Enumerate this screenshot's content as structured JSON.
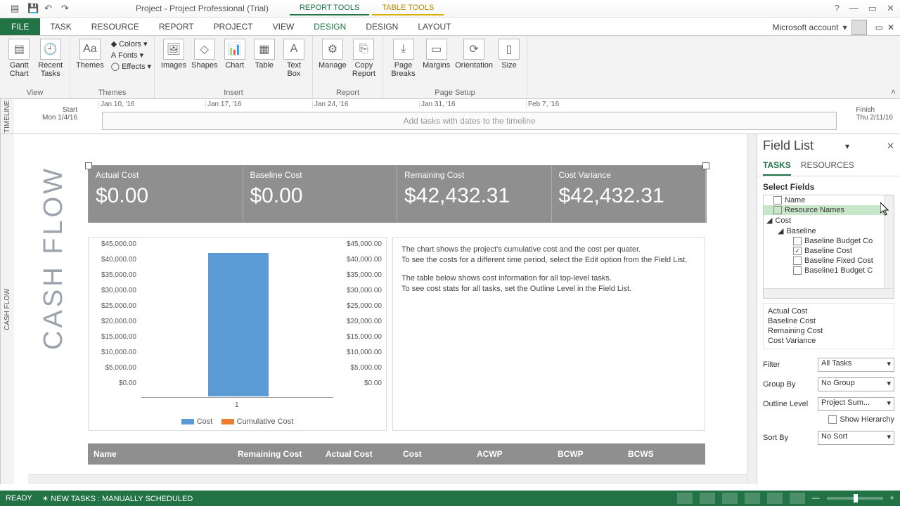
{
  "titlebar": {
    "app_title": "Project - Project Professional (Trial)",
    "tool_tabs": {
      "report": "REPORT TOOLS",
      "table": "TABLE TOOLS"
    }
  },
  "tabs": {
    "file": "FILE",
    "items": [
      "TASK",
      "RESOURCE",
      "REPORT",
      "PROJECT",
      "VIEW",
      "DESIGN",
      "DESIGN",
      "LAYOUT"
    ],
    "active_index": 5,
    "account": "Microsoft account"
  },
  "ribbon": {
    "view": {
      "gantt": "Gantt Chart",
      "recent": "Recent Tasks",
      "label": "View"
    },
    "themes": {
      "themes": "Themes",
      "colors": "Colors",
      "fonts": "Fonts",
      "effects": "Effects",
      "label": "Themes"
    },
    "insert": {
      "images": "Images",
      "shapes": "Shapes",
      "chart": "Chart",
      "table": "Table",
      "textbox": "Text Box",
      "label": "Insert"
    },
    "report": {
      "manage": "Manage",
      "copy": "Copy Report",
      "label": "Report"
    },
    "page": {
      "breaks": "Page Breaks",
      "margins": "Margins",
      "orientation": "Orientation",
      "size": "Size",
      "label": "Page Setup"
    }
  },
  "timeline": {
    "side": "TIMELINE",
    "dates": [
      "Jan 10, '16",
      "Jan 17, '16",
      "Jan 24, '16",
      "Jan 31, '16",
      "Feb 7, '16"
    ],
    "start_label": "Start",
    "start_val": "Mon 1/4/16",
    "finish_label": "Finish",
    "finish_val": "Thu 2/11/16",
    "placeholder": "Add tasks with dates to the timeline"
  },
  "report": {
    "side": "CASH FLOW",
    "title": "CASH FLOW",
    "summary": [
      {
        "label": "Actual Cost",
        "value": "$0.00"
      },
      {
        "label": "Baseline Cost",
        "value": "$0.00"
      },
      {
        "label": "Remaining Cost",
        "value": "$42,432.31"
      },
      {
        "label": "Cost Variance",
        "value": "$42,432.31"
      }
    ],
    "info": {
      "p1": "The chart shows the project's cumulative cost and the cost per quater.",
      "p2": "To see the costs for a different time period, select the Edit option from the Field List.",
      "p3": "The table below shows cost information for all top-level tasks.",
      "p4": "To see cost stats for all tasks, set the Outline Level in the Field List."
    },
    "table_headers": [
      "Name",
      "Remaining Cost",
      "Actual Cost",
      "Cost",
      "ACWP",
      "BCWP",
      "BCWS"
    ]
  },
  "chart_data": {
    "type": "bar",
    "categories": [
      "1"
    ],
    "series": [
      {
        "name": "Cost",
        "values": [
          42432.31
        ],
        "color": "#5b9bd5"
      },
      {
        "name": "Cumulative Cost",
        "values": [
          42432.31
        ],
        "color": "#ed7d31"
      }
    ],
    "y_ticks": [
      "$45,000.00",
      "$40,000.00",
      "$35,000.00",
      "$30,000.00",
      "$25,000.00",
      "$20,000.00",
      "$15,000.00",
      "$10,000.00",
      "$5,000.00",
      "$0.00"
    ],
    "ylim": [
      0,
      45000
    ]
  },
  "fieldlist": {
    "title": "Field List",
    "tabs": {
      "tasks": "TASKS",
      "resources": "RESOURCES"
    },
    "section": "Select Fields",
    "tree": {
      "name": "Name",
      "resource_names": "Resource Names",
      "cost": "Cost",
      "baseline": "Baseline",
      "baseline_budget": "Baseline Budget Co",
      "baseline_cost": "Baseline Cost",
      "baseline_fixed": "Baseline Fixed Cost",
      "baseline1_budget": "Baseline1 Budget C"
    },
    "chosen": [
      "Actual Cost",
      "Baseline Cost",
      "Remaining Cost",
      "Cost Variance"
    ],
    "filter": {
      "label": "Filter",
      "value": "All Tasks"
    },
    "groupby": {
      "label": "Group By",
      "value": "No Group"
    },
    "outline": {
      "label": "Outline Level",
      "value": "Project Sum..."
    },
    "hierarchy": "Show Hierarchy",
    "sortby": {
      "label": "Sort By",
      "value": "No Sort"
    }
  },
  "statusbar": {
    "ready": "READY",
    "sched": "NEW TASKS : MANUALLY SCHEDULED"
  }
}
